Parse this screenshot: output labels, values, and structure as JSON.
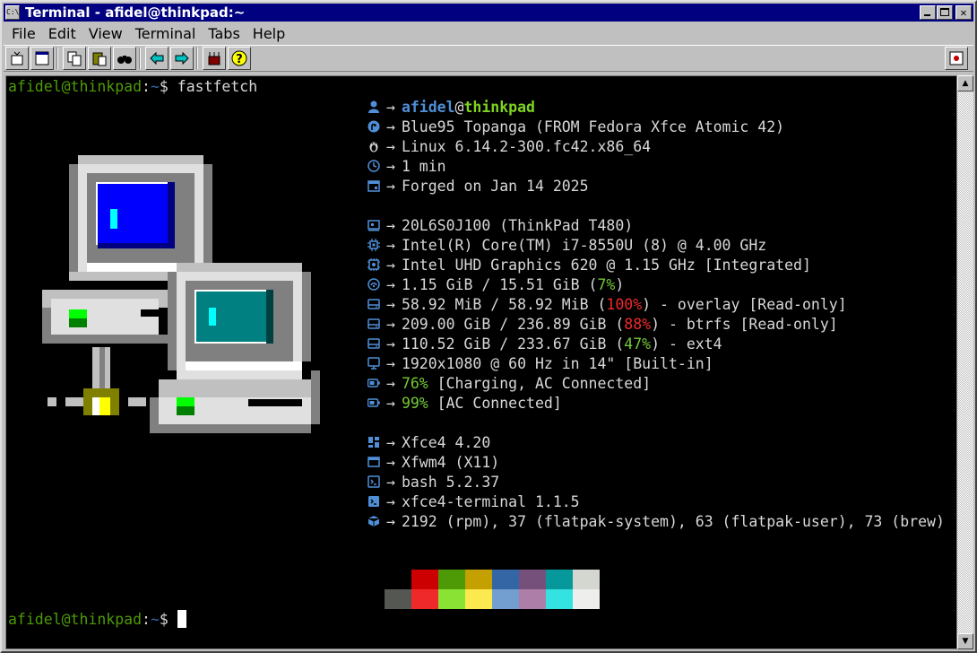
{
  "window": {
    "title": "Terminal - afidel@thinkpad:~",
    "icon_label": "C:\\",
    "buttons": [
      "minimize-icon",
      "maximize-icon",
      "close-icon"
    ]
  },
  "menu": [
    "File",
    "Edit",
    "View",
    "Terminal",
    "Tabs",
    "Help"
  ],
  "toolbar": {
    "buttons": [
      "new-tab-icon",
      "new-window-icon",
      "copy-icon",
      "paste-icon",
      "find-icon",
      "previous-tab-icon",
      "next-tab-icon",
      "preferences-icon",
      "help-icon",
      "fullscreen-icon"
    ]
  },
  "terminal": {
    "prompt1": {
      "user": "afidel@thinkpad",
      "path": "~",
      "symbol": "$",
      "command": "fastfetch"
    },
    "prompt2": {
      "user": "afidel@thinkpad",
      "path": "~",
      "symbol": "$"
    },
    "arrow": "→",
    "header": {
      "user": "afidel",
      "at": "@",
      "host": "thinkpad"
    },
    "info": [
      {
        "icon": "os-icon",
        "text": "Blue95 Topanga (FROM Fedora Xfce Atomic 42)"
      },
      {
        "icon": "kernel-icon",
        "text": "Linux 6.14.2-300.fc42.x86_64"
      },
      {
        "icon": "uptime-icon",
        "text": "1 min"
      },
      {
        "icon": "calendar-icon",
        "text": "Forged on Jan 14 2025"
      },
      {
        "blank": true
      },
      {
        "icon": "host-icon",
        "text": "20L6S0J100 (ThinkPad T480)"
      },
      {
        "icon": "cpu-icon",
        "text": "Intel(R) Core(TM) i7-8550U (8) @ 4.00 GHz"
      },
      {
        "icon": "gpu-icon",
        "text": "Intel UHD Graphics 620 @ 1.15 GHz [Integrated]"
      },
      {
        "icon": "memory-icon",
        "pre": "1.15 GiB / 15.51 GiB (",
        "pct": "7%",
        "pct_color": "green",
        "post": ")"
      },
      {
        "icon": "disk-icon",
        "pre": "58.92 MiB / 58.92 MiB (",
        "pct": "100%",
        "pct_color": "red",
        "post": ") - overlay [Read-only]"
      },
      {
        "icon": "disk-icon",
        "pre": "209.00 GiB / 236.89 GiB (",
        "pct": "88%",
        "pct_color": "red",
        "post": ") - btrfs [Read-only]"
      },
      {
        "icon": "disk-icon",
        "pre": "110.52 GiB / 233.67 GiB (",
        "pct": "47%",
        "pct_color": "green",
        "post": ") - ext4"
      },
      {
        "icon": "display-icon",
        "text": "1920x1080 @ 60 Hz in 14\" [Built-in]"
      },
      {
        "icon": "battery-icon",
        "pre": "",
        "pct": "76%",
        "pct_color": "green",
        "post": " [Charging, AC Connected]"
      },
      {
        "icon": "battery-icon",
        "pre": "",
        "pct": "99%",
        "pct_color": "green",
        "post": " [AC Connected]"
      },
      {
        "blank": true
      },
      {
        "icon": "desktop-environment-icon",
        "text": "Xfce4 4.20"
      },
      {
        "icon": "window-manager-icon",
        "text": "Xfwm4 (X11)"
      },
      {
        "icon": "shell-icon",
        "text": "bash 5.2.37"
      },
      {
        "icon": "terminal-icon",
        "text": "xfce4-terminal 1.1.5"
      },
      {
        "icon": "packages-icon",
        "text": "2192 (rpm), 37 (flatpak-system), 63 (flatpak-user), 73 (brew)"
      }
    ],
    "palette": {
      "normal": [
        "#000000",
        "#cc0000",
        "#4e9a06",
        "#c4a000",
        "#3465a4",
        "#75507b",
        "#06989a",
        "#d3d7cf"
      ],
      "bright": [
        "#555753",
        "#ef2929",
        "#8ae234",
        "#fce94f",
        "#729fcf",
        "#ad7fa8",
        "#34e2e2",
        "#eeeeec"
      ]
    }
  }
}
